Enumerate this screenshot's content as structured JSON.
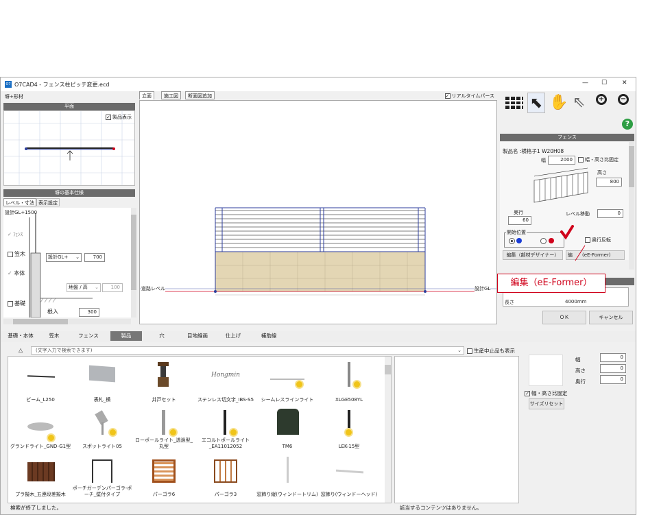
{
  "window": {
    "title": "O7CAD4 - フェンス柱ピッチ変更.ecd",
    "app_icon": "O7",
    "min": "—",
    "max": "☐",
    "close": "✕"
  },
  "left": {
    "section_label": "塀+形材",
    "plan_header": "平面",
    "product_display": "製品表示",
    "spec_header": "塀の基本仕様",
    "tabs": [
      "レベル・寸法",
      "表示設定"
    ],
    "design_gl": "設計GL+",
    "design_gl_val": "1500",
    "fence_label": "ﾌｪﾝｽ",
    "kasagi_label": "笠木",
    "design_gl_select": "設計GL+",
    "kasagi_val": "700",
    "body_label": "本体",
    "ground_select": "地盤 / 高",
    "ground_val": "100",
    "foundation_label": "基礎",
    "nekiri_label": "根入",
    "nekiri_val": "300"
  },
  "center": {
    "tabs": [
      "立面",
      "施工図",
      "断面図追加"
    ],
    "realtime": "リアルタイムパース",
    "road_level": "道路レベル",
    "design_gl": "設計GL"
  },
  "right": {
    "header": "フェンス",
    "product_name": "製品名 :横格子1 W20H08",
    "width_label": "幅",
    "width_val": "2000",
    "ratio_fix": "幅・高さ比固定",
    "height_label": "高さ",
    "height_val": "800",
    "depth_label": "奥行",
    "depth_val": "60",
    "level_move": "レベル移動",
    "level_val": "0",
    "start_pos": "開始位置",
    "depth_flip": "奥行反転",
    "edit_designer": "編集（部材デザイナー）",
    "edit_prefix": "編",
    "edit_eformer": "(eE-Former)",
    "callout": "編集（eE-Former）",
    "length_label": "長さ",
    "length_val": "4000mm",
    "ok": "ＯＫ",
    "cancel": "キャンセル",
    "help": "?"
  },
  "categories": [
    "基礎・本体",
    "笠木",
    "フェンス",
    "製品",
    "穴",
    "目地線画",
    "仕上げ",
    "補助線"
  ],
  "search": {
    "placeholder": "(文字入力で検索できます)",
    "discontinued": "生産中止品も表示"
  },
  "items": [
    {
      "label": "ビーム_L250"
    },
    {
      "label": "表札_横"
    },
    {
      "label": "井戸セット"
    },
    {
      "label": "ステンレス切文字_IBS-S5"
    },
    {
      "label": "シームレスラインライト"
    },
    {
      "label": "XLGE508YL"
    },
    {
      "label": "グランドライト_GND-G1型"
    },
    {
      "label": "スポットライト05"
    },
    {
      "label": "ローポールライト_透過型_丸型"
    },
    {
      "label": "エコルトポールライト_EA11012052"
    },
    {
      "label": "TM6"
    },
    {
      "label": "LEK-15型"
    },
    {
      "label": "プラ擬木_五連段差擬木"
    },
    {
      "label": "ポーチガーデンパーゴラ-ポーチ_壁付タイプ"
    },
    {
      "label": "パーゴラ6"
    },
    {
      "label": "パーゴラ3"
    },
    {
      "label": "窓飾り縦(ウィンドートリム)"
    },
    {
      "label": "窓飾り(ウィンドーヘッド)"
    }
  ],
  "logo_text": "Hongmin",
  "preview": {
    "width_label": "幅",
    "width_val": "0",
    "height_label": "高さ",
    "height_val": "0",
    "depth_label": "奥行",
    "depth_val": "0",
    "ratio_fix": "幅・高さ比固定",
    "size_reset": "サイズリセット"
  },
  "status": {
    "left": "検索が終了しました。",
    "right": "該当するコンテンツはありません。"
  },
  "colors": {
    "accent_red": "#d0021b",
    "panel_header": "#6b6b6b",
    "wall_fill": "#e3d6b4",
    "grid_blue": "#2c3e9c"
  }
}
